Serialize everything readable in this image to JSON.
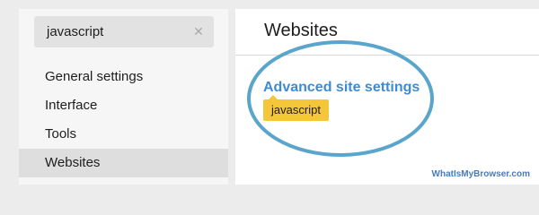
{
  "search": {
    "value": "javascript",
    "clear_icon": "close-icon"
  },
  "sidebar": {
    "items": [
      {
        "label": "General settings"
      },
      {
        "label": "Interface"
      },
      {
        "label": "Tools"
      },
      {
        "label": "Websites",
        "selected": true
      }
    ]
  },
  "panel": {
    "title": "Websites",
    "link_label": "Advanced site settings",
    "tag_label": "javascript"
  },
  "annotation": {
    "ring_color": "#5aa5cb",
    "tag_color": "#f6c639"
  },
  "watermark": "WhatIsMyBrowser.com"
}
